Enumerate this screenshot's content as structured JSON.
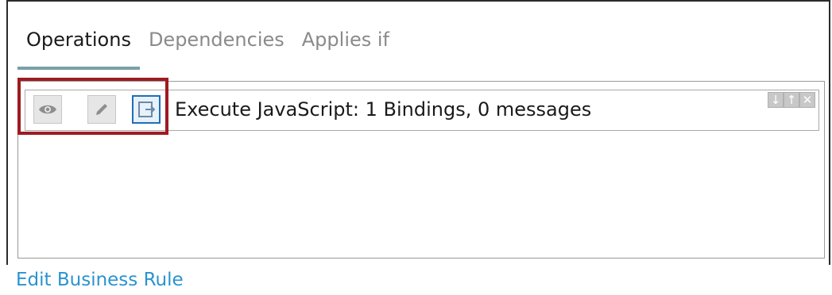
{
  "tabs": [
    {
      "label": "Operations",
      "active": true
    },
    {
      "label": "Dependencies",
      "active": false
    },
    {
      "label": "Applies if",
      "active": false
    }
  ],
  "operation_row": {
    "text": "Execute JavaScript: 1 Bindings, 0 messages",
    "buttons": [
      {
        "icon": "eye-icon"
      },
      {
        "icon": "pencil-icon"
      },
      {
        "icon": "export-icon"
      }
    ],
    "sort_controls": [
      "↓",
      "↑",
      "✕"
    ]
  },
  "footer": {
    "edit_link": "Edit Business Rule"
  },
  "colors": {
    "link": "#2a93cf",
    "highlight": "#9e1b22",
    "active_tab_underline": "#7aa0a8"
  }
}
